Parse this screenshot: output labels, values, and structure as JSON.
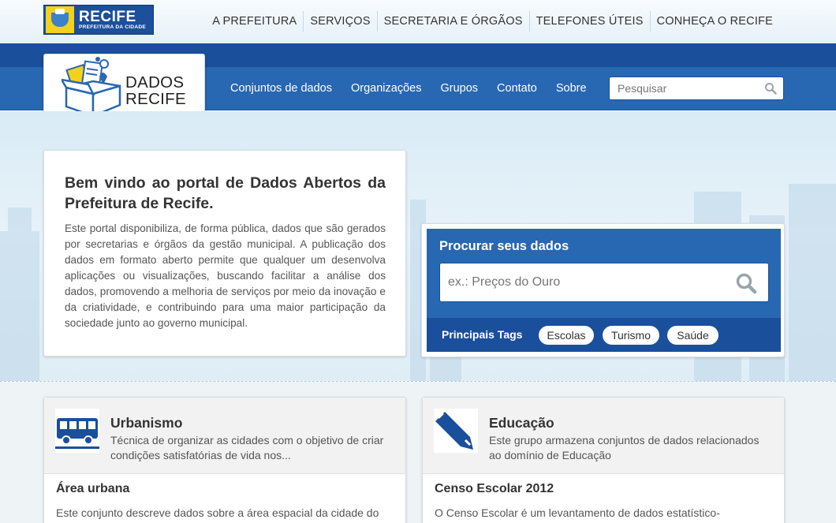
{
  "brand": {
    "recife_name": "RECIFE",
    "recife_subtitle": "PREFEITURA DA CIDADE",
    "portal_line1": "DADOS",
    "portal_line2": "RECIFE"
  },
  "top_nav": [
    "A PREFEITURA",
    "SERVIÇOS",
    "SECRETARIA E ÓRGÃOS",
    "TELEFONES ÚTEIS",
    "CONHEÇA O RECIFE"
  ],
  "main_nav": [
    "Conjuntos de dados",
    "Organizações",
    "Grupos",
    "Contato",
    "Sobre"
  ],
  "header_search": {
    "placeholder": "Pesquisar"
  },
  "welcome": {
    "title": "Bem vindo ao portal de Dados Abertos da Prefeitura de Recife.",
    "body": "Este portal disponibiliza, de forma pública, dados que são gerados por secretarias e órgãos da gestão municipal. A publicação dos dados em formato aberto permite que qualquer um desenvolva aplicações ou visualizações, buscando facilitar a análise dos dados, promovendo a melhoria de serviços por meio da inovação e da criatividade, e contribuindo para uma maior participação da sociedade junto ao governo municipal."
  },
  "search_box": {
    "title": "Procurar seus dados",
    "placeholder": "ex.: Preços do Ouro",
    "tags_label": "Principais Tags",
    "tags": [
      "Escolas",
      "Turismo",
      "Saúde"
    ]
  },
  "groups": [
    {
      "icon": "bus-icon",
      "title": "Urbanismo",
      "description": "Técnica de organizar as cidades com o objetivo de criar condições satisfatórias de vida nos...",
      "dataset_title": "Área urbana",
      "dataset_description": "Este conjunto descreve dados sobre a área espacial da cidade do"
    },
    {
      "icon": "pencil-icon",
      "title": "Educação",
      "description": "Este grupo armazena conjuntos de dados relacionados ao domínio de Educação",
      "dataset_title": "Censo Escolar 2012",
      "dataset_description": "O Censo Escolar é um levantamento de dados estatístico-"
    }
  ],
  "colors": {
    "header_dark": "#1a4f9c",
    "header_main": "#2867b2",
    "hero_bg": "#dcecf6",
    "logo_yellow": "#f4d21c"
  }
}
